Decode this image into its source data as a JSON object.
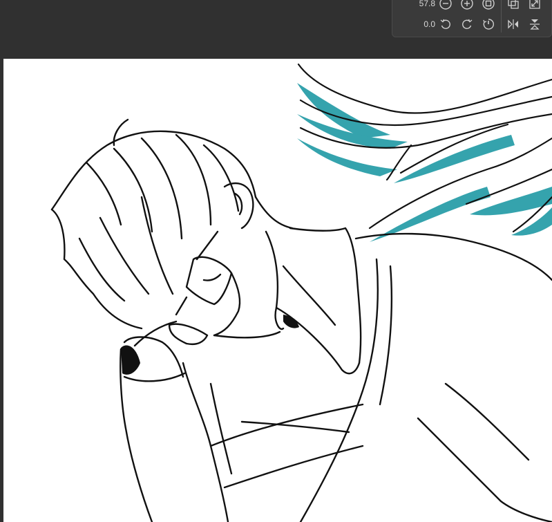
{
  "navigator": {
    "zoom_value": "57.8",
    "rotation_value": "0.0",
    "zoom_out_icon": "minus-circle-icon",
    "zoom_in_icon": "plus-circle-icon",
    "fit_icon": "square-circle-icon",
    "rotate_ccw_icon": "rotate-left-icon",
    "rotate_cw_icon": "rotate-right-icon",
    "reset_rotation_icon": "rotation-reset-icon",
    "flip_horizontal_icon": "flip-horizontal-icon",
    "flip_vertical_icon": "flip-vertical-icon",
    "actual_size_icon": "actual-size-icon",
    "fit_window_icon": "fit-window-icon"
  },
  "colors": {
    "ui_background": "#303030",
    "panel_background": "#3a3a3a",
    "icon_color": "#d0d0d0",
    "canvas_background": "#ffffff",
    "line_art": "#111111",
    "wing_shadow": "#35a3ad"
  }
}
